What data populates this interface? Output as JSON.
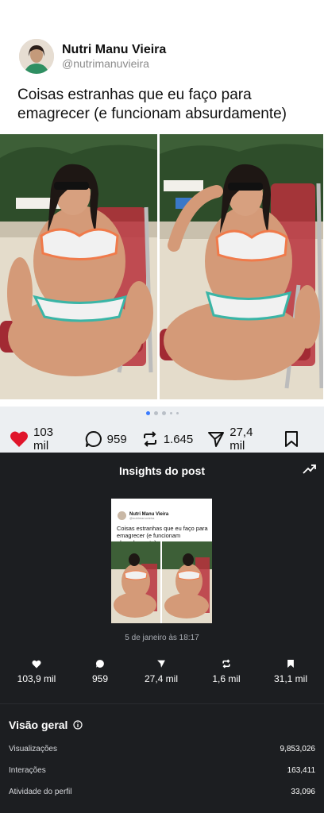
{
  "post": {
    "author_name": "Nutri Manu Vieira",
    "author_handle": "@nutrimanuvieira",
    "caption": "Coisas estranhas que eu faço para emagrecer (e funcionam absurdamente)"
  },
  "actions": {
    "likes": "103 mil",
    "comments": "959",
    "reposts": "1.645",
    "shares": "27,4 mil",
    "carousel_pages": 5,
    "carousel_current": 1,
    "like_color": "#e0152b"
  },
  "insights": {
    "title": "Insights do post",
    "date": "5 de janeiro às 18:17",
    "stats": {
      "likes": "103,9 mil",
      "comments": "959",
      "shares": "27,4 mil",
      "reposts": "1,6 mil",
      "saves": "31,1 mil"
    },
    "overview_title": "Visão geral",
    "metrics": [
      {
        "label": "Visualizações",
        "value": "9,853,026"
      },
      {
        "label": "Interações",
        "value": "163,411"
      },
      {
        "label": "Atividade do perfil",
        "value": "33,096"
      }
    ]
  },
  "icons": {
    "like": "heart-icon",
    "comment": "comment-bubble-icon",
    "repost": "repost-arrows-icon",
    "share": "send-paper-plane-icon",
    "save": "bookmark-icon",
    "trend": "trending-up-icon",
    "info": "info-circle-icon"
  }
}
